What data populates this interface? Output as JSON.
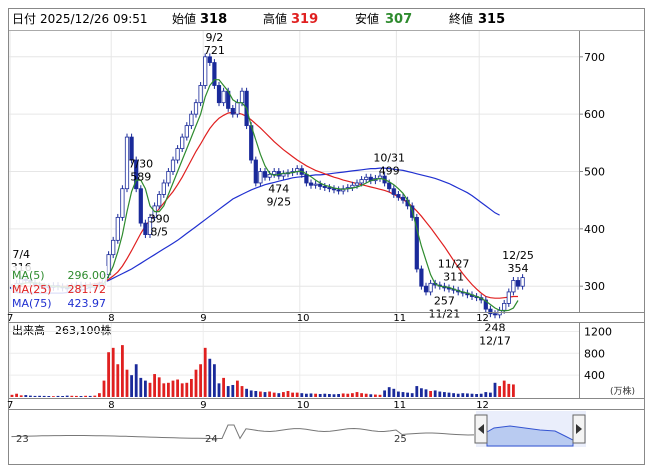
{
  "header": {
    "date_label": "日付",
    "datetime": "2025/12/26 09:51",
    "open_label": "始値",
    "open": "318",
    "high_label": "高値",
    "high": "319",
    "low_label": "安値",
    "low": "307",
    "close_label": "終値",
    "close": "315"
  },
  "legend": [
    {
      "label": "MA(5)",
      "value": "296.00",
      "color": "#2e8b2e"
    },
    {
      "label": "MA(25)",
      "value": "281.72",
      "color": "#e02020"
    },
    {
      "label": "MA(75)",
      "value": "423.97",
      "color": "#2030d0"
    }
  ],
  "volume_header": {
    "label": "出来高",
    "value": "263,100株"
  },
  "volume_unit": "(万株)",
  "price_ticks": [
    "700",
    "600",
    "500",
    "400",
    "300"
  ],
  "volume_ticks": [
    "1200",
    "800",
    "400"
  ],
  "month_labels": [
    "7",
    "8",
    "9",
    "10",
    "11",
    "12"
  ],
  "nav_labels": [
    "23",
    "24",
    "25"
  ],
  "annotations": [
    {
      "text": "7/4",
      "value": "316"
    },
    {
      "text": "7/30",
      "value": "589"
    },
    {
      "text": "390",
      "value": "8/5"
    },
    {
      "text": "9/2",
      "value": "721"
    },
    {
      "text": "474",
      "value": "9/25"
    },
    {
      "text": "10/31",
      "value": "499"
    },
    {
      "text": "11/27",
      "value": "311"
    },
    {
      "text": "257",
      "value": "11/21"
    },
    {
      "text": "248",
      "value": "12/17"
    },
    {
      "text": "12/25",
      "value": "354"
    }
  ],
  "colors": {
    "up": "#ffffff",
    "down": "#1a2a9a",
    "ma5": "#2e8b2e",
    "ma25": "#e02020",
    "ma75": "#2030d0",
    "vol_up": "#e02020",
    "vol_down": "#1a2a9a"
  },
  "chart_data": {
    "type": "candlestick",
    "ylim": [
      255,
      745
    ],
    "volume_ylim": [
      0,
      1300
    ],
    "months": [
      {
        "label": "7",
        "start": 0
      },
      {
        "label": "8",
        "start": 22
      },
      {
        "label": "9",
        "start": 42
      },
      {
        "label": "10",
        "start": 63
      },
      {
        "label": "11",
        "start": 84
      },
      {
        "label": "12",
        "start": 102
      }
    ],
    "close": [
      298,
      305,
      312,
      310,
      306,
      302,
      300,
      299,
      298,
      301,
      299,
      297,
      296,
      300,
      302,
      299,
      301,
      298,
      300,
      302,
      320,
      355,
      380,
      420,
      470,
      560,
      520,
      470,
      410,
      390,
      420,
      440,
      460,
      480,
      500,
      520,
      540,
      560,
      580,
      600,
      620,
      650,
      700,
      690,
      650,
      620,
      640,
      610,
      600,
      620,
      640,
      580,
      520,
      480,
      500,
      490,
      495,
      500,
      492,
      496,
      498,
      500,
      505,
      495,
      480,
      476,
      478,
      474,
      472,
      470,
      468,
      466,
      470,
      472,
      476,
      480,
      486,
      490,
      484,
      488,
      492,
      480,
      470,
      460,
      455,
      450,
      440,
      420,
      330,
      300,
      290,
      305,
      302,
      300,
      297,
      295,
      293,
      290,
      288,
      285,
      282,
      280,
      276,
      260,
      252,
      250,
      258,
      270,
      290,
      310,
      300,
      315
    ],
    "volume": [
      40,
      60,
      30,
      35,
      25,
      20,
      22,
      20,
      18,
      15,
      20,
      18,
      25,
      22,
      20,
      18,
      22,
      20,
      25,
      70,
      300,
      820,
      900,
      600,
      950,
      500,
      400,
      600,
      350,
      300,
      260,
      420,
      360,
      250,
      260,
      300,
      320,
      250,
      260,
      330,
      500,
      600,
      900,
      700,
      600,
      250,
      350,
      200,
      220,
      300,
      200,
      150,
      120,
      110,
      100,
      90,
      100,
      80,
      70,
      90,
      110,
      80,
      80,
      70,
      60,
      65,
      60,
      55,
      60,
      55,
      50,
      55,
      65,
      60,
      70,
      90,
      70,
      60,
      50,
      45,
      40,
      120,
      180,
      150,
      100,
      90,
      80,
      70,
      200,
      160,
      140,
      110,
      120,
      100,
      90,
      80,
      70,
      60,
      70,
      65,
      60,
      55,
      60,
      90,
      80,
      260,
      200,
      300,
      240,
      230
    ],
    "ma5": [
      298,
      300,
      303,
      306,
      306,
      306,
      305,
      303,
      301,
      300,
      299,
      299,
      298,
      299,
      300,
      300,
      301,
      300,
      300,
      300,
      305,
      318,
      335,
      360,
      390,
      430,
      465,
      485,
      485,
      470,
      440,
      430,
      430,
      440,
      460,
      480,
      500,
      520,
      540,
      560,
      580,
      600,
      630,
      650,
      660,
      660,
      650,
      640,
      625,
      620,
      620,
      610,
      580,
      555,
      530,
      510,
      497,
      493,
      495,
      497,
      497,
      498,
      500,
      500,
      496,
      491,
      485,
      480,
      476,
      474,
      471,
      470,
      469,
      470,
      471,
      473,
      476,
      480,
      484,
      486,
      488,
      486,
      482,
      477,
      470,
      462,
      450,
      432,
      400,
      370,
      345,
      320,
      304,
      300,
      299,
      298,
      295,
      292,
      290,
      288,
      285,
      282,
      279,
      274,
      268,
      262,
      258,
      257,
      258,
      262,
      275
    ],
    "ma25": [
      300,
      300,
      300,
      300,
      300,
      300,
      300,
      300,
      300,
      300,
      300,
      300,
      300,
      300,
      300,
      301,
      302,
      303,
      304,
      306,
      308,
      312,
      318,
      325,
      335,
      348,
      362,
      377,
      392,
      405,
      415,
      425,
      435,
      445,
      455,
      465,
      477,
      490,
      505,
      520,
      535,
      548,
      562,
      575,
      585,
      593,
      598,
      602,
      603,
      602,
      600,
      596,
      590,
      583,
      576,
      568,
      560,
      552,
      545,
      538,
      532,
      526,
      520,
      515,
      510,
      506,
      502,
      499,
      496,
      493,
      490,
      488,
      485,
      483,
      481,
      479,
      477,
      475,
      473,
      471,
      469,
      467,
      464,
      460,
      456,
      451,
      446,
      439,
      431,
      422,
      412,
      402,
      391,
      380,
      369,
      357,
      345,
      333,
      322,
      312,
      303,
      295,
      288,
      282,
      280,
      279,
      279,
      280,
      281,
      282,
      282
    ],
    "ma75": [
      290,
      289,
      288,
      288,
      288,
      288,
      288,
      288,
      288,
      288,
      288,
      288,
      289,
      290,
      291,
      293,
      295,
      298,
      301,
      304,
      307,
      310,
      314,
      318,
      322,
      326,
      330,
      335,
      340,
      345,
      350,
      355,
      360,
      365,
      370,
      375,
      380,
      386,
      392,
      398,
      404,
      410,
      416,
      422,
      428,
      434,
      440,
      446,
      452,
      456,
      460,
      464,
      468,
      471,
      474,
      477,
      479,
      481,
      483,
      485,
      487,
      489,
      490,
      491,
      492,
      493,
      494,
      494,
      495,
      496,
      497,
      498,
      499,
      500,
      501,
      502,
      503,
      504,
      505,
      505,
      506,
      506,
      505,
      504,
      503,
      502,
      500,
      498,
      496,
      494,
      492,
      490,
      488,
      485,
      482,
      479,
      475,
      471,
      467,
      463,
      458,
      452,
      446,
      440,
      434,
      428,
      424
    ]
  }
}
